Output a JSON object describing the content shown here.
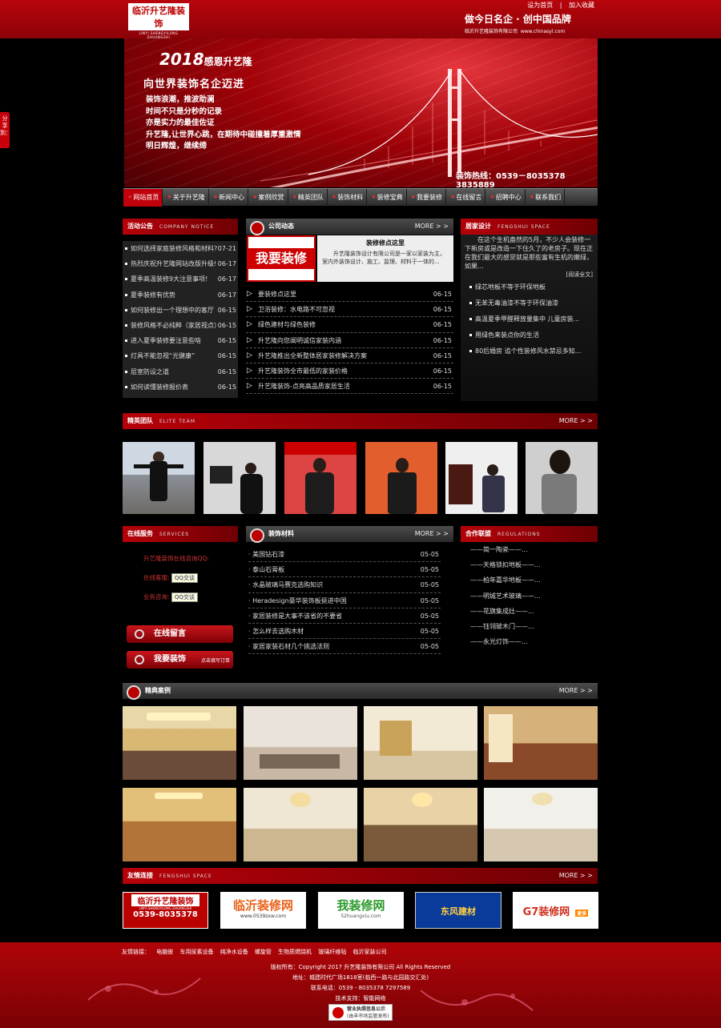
{
  "header": {
    "logo_name": "临沂升艺隆装饰",
    "logo_pinyin": "LINYI SHENGYILONG ZHUANGSHI",
    "logo_phone": "0539-8035378",
    "links": [
      "设为首页",
      "|",
      "加入收藏"
    ],
    "slogan_main": "做今日名企 · 创中国品牌",
    "slogan_company": "临沂升艺隆装饰有限公司",
    "slogan_url": "www.chinasyl.com"
  },
  "banner": {
    "year": "2018",
    "year_text": "感恩升艺隆",
    "headline": "向世界装饰名企迈进",
    "lines": [
      "装饰浪潮，推波助澜",
      "时间不只是分秒的记录",
      "亦是实力的最佳佐证",
      "升艺隆,让世界心跳，在期待中碰撞着厚重激情",
      "明日辉煌，继续缔"
    ],
    "hotline": "装饰热线：0539－8035378  3835889"
  },
  "share": "分享到：",
  "nav": [
    "网站首页",
    "关于升艺隆",
    "新闻中心",
    "案例欣赏",
    "精英团队",
    "装饰材料",
    "装修宝典",
    "我要装修",
    "在线留言",
    "招聘中心",
    "联系我们"
  ],
  "notice": {
    "title": "活动公告",
    "en": "COMPANY NOTICE",
    "items": [
      {
        "t": "如何选择家庭装修风格和材料?",
        "d": "07-21"
      },
      {
        "t": "热烈庆祝升艺隆网站改版升级!",
        "d": "06-17"
      },
      {
        "t": "夏季高温装修9大注意事项!",
        "d": "06-17"
      },
      {
        "t": "夏季装修有优势",
        "d": "06-17"
      },
      {
        "t": "如何装修出一个理想中的客厅",
        "d": "06-15"
      },
      {
        "t": "装修风格不必纯粹（家居视点）",
        "d": "06-15"
      },
      {
        "t": "进入夏季装修要注意些啥",
        "d": "06-15"
      },
      {
        "t": "灯具不能忽视“光健康”",
        "d": "06-15"
      },
      {
        "t": "层室防设之道",
        "d": "06-15"
      },
      {
        "t": "如何读懂装修报价表",
        "d": "06-15"
      }
    ]
  },
  "news": {
    "title": "公司动态",
    "more": "MORE > >",
    "feature_img": "我要装修",
    "feature_title": "装修修点这里",
    "feature_text": "升艺隆装饰设计有限公司是一家以家装为主，室内外装饰设计、施工、监理、材料于一体的...",
    "items": [
      {
        "t": "要装修点这里",
        "d": "06-15"
      },
      {
        "t": "卫浴装修：水电路不可忽视",
        "d": "06-15"
      },
      {
        "t": "绿色建材与绿色装修",
        "d": "06-15"
      },
      {
        "t": "升艺隆向您阐明诚信家装内涵",
        "d": "06-15"
      },
      {
        "t": "升艺隆推出全新整体居家装修解决方案",
        "d": "06-15"
      },
      {
        "t": "升艺隆装饰全市最低的家装价格",
        "d": "06-15"
      },
      {
        "t": "升艺隆装饰-点亮高品质家居生活",
        "d": "06-15"
      }
    ]
  },
  "fengshui": {
    "title": "居家设计",
    "en": "FENGSHUI SPACE",
    "intro": "在这个生机盎然的5月，不少人会装修一下新房或是改造一下住久了的老房子。现在正在我们最大的感觉就是那些富有生机的嫩绿，如果...",
    "read_more": "[阅读全文]",
    "items": [
      "绿芯地板不等于环保地板",
      "无苯无毒油漆不等于环保油漆",
      "高温夏季甲醛释放量集中 儿童房装...",
      "用绿色来装点你的生活",
      "80后婚房 追个性装修风水禁忌多知..."
    ]
  },
  "team": {
    "title": "精英团队",
    "en": "ELITE TEAM",
    "more": "MORE > >"
  },
  "service": {
    "title": "在线服务",
    "en": "SERVICES",
    "qq_prompt": "升艺隆装饰在线咨询QQ:",
    "rows": [
      {
        "label": "在线客服:",
        "btn": "QQ交谈"
      },
      {
        "label": "业务咨询:",
        "btn": "QQ交谈"
      }
    ],
    "btn_message": "在线留言",
    "btn_decorate": "我要装饰",
    "btn_decorate_note": "点击填写订单"
  },
  "materials": {
    "title": "装饰材料",
    "more": "MORE > >",
    "items": [
      {
        "t": "· 美国钻石漆",
        "d": "05-05"
      },
      {
        "t": "· 泰山石膏板",
        "d": "05-05"
      },
      {
        "t": "· 水晶玻璃马赛克选购知识",
        "d": "05-05"
      },
      {
        "t": "· Heradesign豪华装饰板挺进中国",
        "d": "05-05"
      },
      {
        "t": "· 家居装修是大事不该省的不要省",
        "d": "05-05"
      },
      {
        "t": "· 怎么样去选购木材",
        "d": "05-05"
      },
      {
        "t": "· 家居家装石材几个挑选法则",
        "d": "05-05"
      }
    ]
  },
  "partners": {
    "title": "合作联盟",
    "en": "REGULATIONS",
    "items": [
      "——简一陶瓷——...",
      "——天格锁扣地板——...",
      "——柏年嘉华地板——...",
      "——明城艺术玻璃——...",
      "——花旗集成灶——...",
      "——钰翎玻木门——...",
      "——永光灯饰——..."
    ]
  },
  "cases": {
    "title": "精典案例",
    "more": "MORE > >"
  },
  "friends": {
    "title": "友情连接",
    "en": "FENGSHUI SPACE",
    "more": "MORE > >",
    "logos": [
      "临沂升艺隆装饰",
      "临沂装修网",
      "我装修网",
      "东风建材",
      "G7装修网"
    ],
    "logo_sub1": "LINYI SHENGYILONG ZHUANGSHI",
    "logo_sub2": "0539-8035378",
    "logo_sub3": "www.0539zxw.com",
    "logo_sub4": "52huangxiu.com",
    "logo_sub5": "更多"
  },
  "footer": {
    "links_label": "友情链接：",
    "links": [
      "电脑彼",
      "车用尿素设备",
      "纯净水设备",
      "螺旋管",
      "生物质燃烧机",
      "玻璃纤维毡",
      "临沂家装公司"
    ],
    "copyright": "版权所有：Copyright 2017 升艺隆装饰有限公司 All Rights Reserved",
    "address": "地址：城建时代广场1818室(临西一路与北园路交汇处)",
    "phone": "联系电话：0539 - 8035378  7297589",
    "support": "技术支持：智能网络",
    "badge_1": "营业执照信息公示",
    "badge_2": "(由丰市场监管发布)"
  },
  "colors": {
    "brand_red": "#b8050c",
    "nav_active": "#c0000a",
    "panel_bg": "#0a0a0a"
  }
}
